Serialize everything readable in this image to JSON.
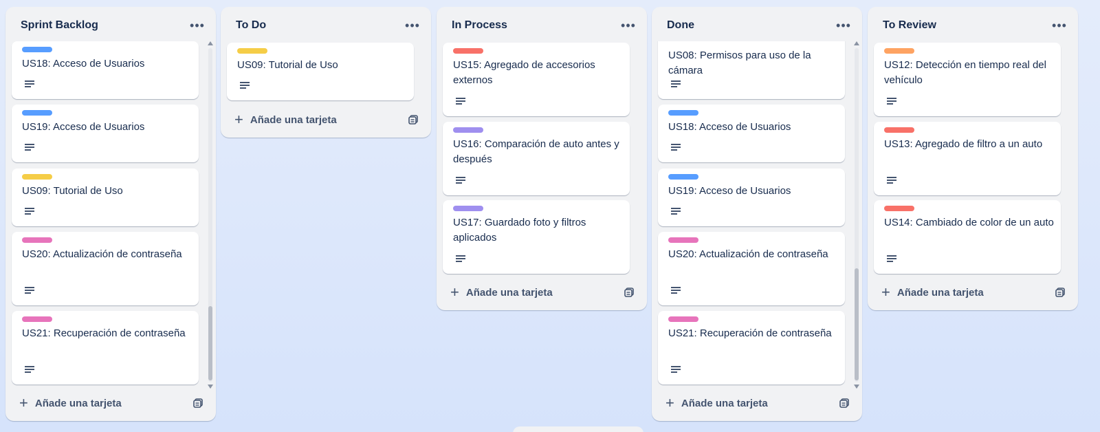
{
  "colors": {
    "blue": "#579dff",
    "yellow": "#f5cd47",
    "pink": "#e774bb",
    "red": "#f87168",
    "purple": "#9f8fef",
    "orange": "#fea362"
  },
  "icons": {
    "menu": "more-horizontal-icon",
    "description": "description-icon",
    "add": "plus-icon",
    "template": "card-template-icon"
  },
  "add_card_label": "Añade una tarjeta",
  "lists": [
    {
      "title": "Sprint Backlog",
      "cards": [
        {
          "label_color": "blue",
          "title": "US18: Acceso de Usuarios"
        },
        {
          "label_color": "blue",
          "title": "US19: Acceso de Usuarios"
        },
        {
          "label_color": "yellow",
          "title": "US09: Tutorial de Uso"
        },
        {
          "label_color": "pink",
          "title": "US20: Actualización de contraseña"
        },
        {
          "label_color": "pink",
          "title": "US21: Recuperación de contraseña"
        }
      ]
    },
    {
      "title": "To Do",
      "cards": [
        {
          "label_color": "yellow",
          "title": "US09: Tutorial de Uso"
        }
      ]
    },
    {
      "title": "In Process",
      "cards": [
        {
          "label_color": "red",
          "title": "US15: Agregado de accesorios externos"
        },
        {
          "label_color": "purple",
          "title": "US16: Comparación de auto antes y después"
        },
        {
          "label_color": "purple",
          "title": "US17: Guardado foto y filtros aplicados"
        }
      ]
    },
    {
      "title": "Done",
      "cards": [
        {
          "label_color": "",
          "title": "US08: Permisos para uso de la cámara"
        },
        {
          "label_color": "blue",
          "title": "US18: Acceso de Usuarios"
        },
        {
          "label_color": "blue",
          "title": "US19: Acceso de Usuarios"
        },
        {
          "label_color": "pink",
          "title": "US20: Actualización de contraseña"
        },
        {
          "label_color": "pink",
          "title": "US21: Recuperación de contraseña"
        }
      ]
    },
    {
      "title": "To Review",
      "cards": [
        {
          "label_color": "orange",
          "title": "US12: Detección en tiempo real del vehículo"
        },
        {
          "label_color": "red",
          "title": "US13: Agregado de filtro a un auto"
        },
        {
          "label_color": "red",
          "title": "US14: Cambiado de color de un auto"
        }
      ]
    }
  ]
}
